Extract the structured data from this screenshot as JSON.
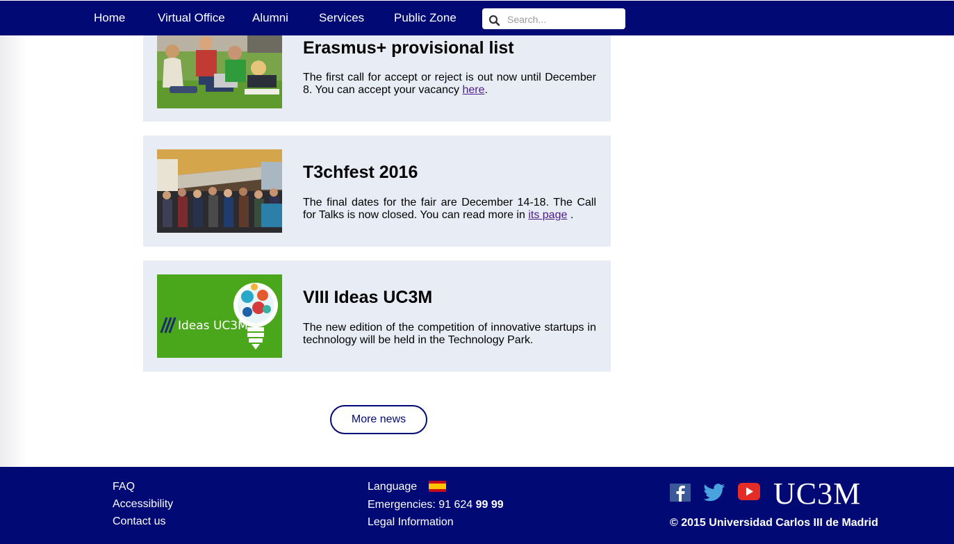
{
  "nav": {
    "items": [
      {
        "label": "Home"
      },
      {
        "label": "Virtual Office"
      },
      {
        "label": "Alumni"
      },
      {
        "label": "Services"
      },
      {
        "label": "Public Zone"
      }
    ],
    "search": {
      "placeholder": "Search...",
      "value": "",
      "icon": "search-icon"
    }
  },
  "news": [
    {
      "title": "Erasmus+ provisional list",
      "text_before": "The first call for accept or reject is out now until December 8. You can accept your vacancy ",
      "link": "here",
      "text_after": "."
    },
    {
      "title": "T3chfest 2016",
      "text_before": "The final dates for the fair are December 14-18. The Call for Talks is now closed. You can read more in ",
      "link": "its page",
      "text_after": " ."
    },
    {
      "title": "VIII Ideas UC3M",
      "text": "The new edition of the competition of innovative startups in technology will be held in the Technology Park.",
      "image_label": "Ideas UC3M"
    }
  ],
  "more_news_label": "More news",
  "footer": {
    "links": [
      {
        "label": "FAQ"
      },
      {
        "label": "Accessibility"
      },
      {
        "label": "Contact us"
      }
    ],
    "language_label": "Language",
    "emergencies_label": "Emergencies: 91 624 ",
    "emergencies_bold": "99 99",
    "legal_label": "Legal Information",
    "logo_text": "UC3M",
    "copyright": "© 2015 Universidad Carlos III de Madrid",
    "social": [
      "facebook-icon",
      "twitter-icon",
      "youtube-icon"
    ]
  },
  "colors": {
    "brand": "#010a74",
    "card_bg": "#e8ecf5",
    "link": "#4b1a8c",
    "ideas_green": "#4aa61a"
  }
}
